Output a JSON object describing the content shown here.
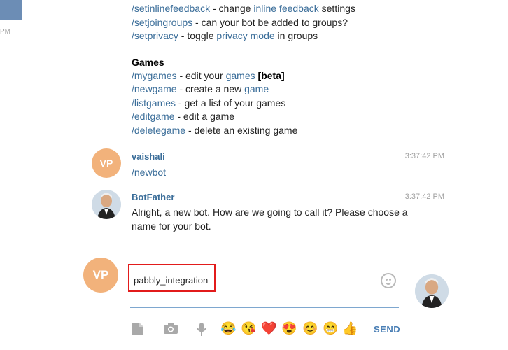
{
  "left_panel": {
    "time_fragment": "PM"
  },
  "commands_top": [
    {
      "cmd": "/setinlinefeedback",
      "text1": " - change ",
      "link": "inline feedback",
      "text2": " settings"
    },
    {
      "cmd": "/setjoingroups",
      "text1": " - can your bot be added to groups?",
      "link": "",
      "text2": ""
    },
    {
      "cmd": "/setprivacy",
      "text1": " - toggle ",
      "link": "privacy mode",
      "text2": " in groups"
    }
  ],
  "games": {
    "heading": "Games",
    "items": [
      {
        "cmd": "/mygames",
        "text1": " - edit your ",
        "link": "games",
        "text2": " ",
        "tag": "[beta]"
      },
      {
        "cmd": "/newgame",
        "text1": " - create a new ",
        "link": "game",
        "text2": "",
        "tag": ""
      },
      {
        "cmd": "/listgames",
        "text1": " - get a list of your games",
        "link": "",
        "text2": "",
        "tag": ""
      },
      {
        "cmd": "/editgame",
        "text1": " - edit a game",
        "link": "",
        "text2": "",
        "tag": ""
      },
      {
        "cmd": "/deletegame",
        "text1": " - delete an existing game",
        "link": "",
        "text2": "",
        "tag": ""
      }
    ]
  },
  "messages": [
    {
      "sender": "vaishali",
      "avatar_initials": "VP",
      "time": "3:37:42 PM",
      "text": "/newbot"
    },
    {
      "sender": "BotFather",
      "avatar_initials": "",
      "time": "3:37:42 PM",
      "text": "Alright, a new bot. How are we going to call it? Please choose a name for your bot."
    }
  ],
  "composer": {
    "avatar_initials": "VP",
    "input_value": "pabbly_integration",
    "send_label": "SEND"
  },
  "toolbar_icons": [
    "file-icon",
    "camera-icon",
    "microphone-icon"
  ],
  "quick_emojis": [
    "😂",
    "😘",
    "❤️",
    "😍",
    "😊",
    "😁",
    "👍"
  ],
  "colors": {
    "link": "#3a6d99",
    "avatar": "#f2b27b",
    "send": "#4a7fb5",
    "highlight_border": "#e21b1b"
  }
}
